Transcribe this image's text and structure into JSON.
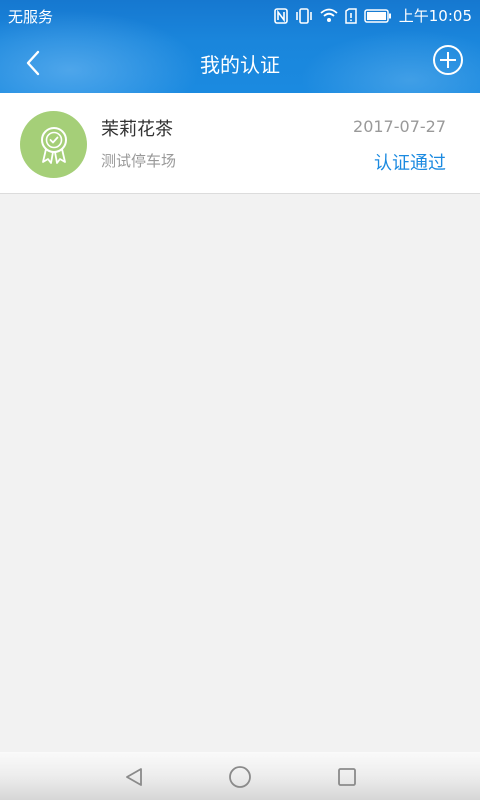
{
  "status_bar": {
    "carrier": "无服务",
    "time": "上午10:05",
    "icons": [
      "nfc-icon",
      "vibrate-icon",
      "wifi-icon",
      "sim-icon",
      "battery-icon"
    ]
  },
  "nav": {
    "title": "我的认证",
    "back_icon": "chevron-left-icon",
    "add_icon": "plus-circle-icon"
  },
  "certifications": [
    {
      "name": "茉莉花茶",
      "subtitle": "测试停车场",
      "date": "2017-07-27",
      "status": "认证通过",
      "icon": "certificate-badge-icon"
    }
  ],
  "system_nav": {
    "icons": [
      "back-triangle-icon",
      "home-circle-icon",
      "recents-square-icon"
    ]
  },
  "colors": {
    "header": "#1b8ae0",
    "accent": "#1b8ae0",
    "avatar_bg": "#a5cf78",
    "page_bg": "#f2f2f2"
  }
}
